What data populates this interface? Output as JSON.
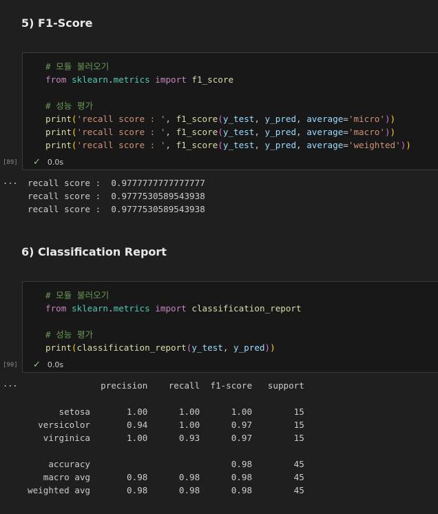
{
  "sections": [
    {
      "heading": "5) F1-Score",
      "exec_count": "[89]",
      "status_time": "0.0s",
      "output_indicator": "...",
      "code": {
        "comment1": "# 모듈 불러오기",
        "from": "from",
        "mod_sk": "sklearn",
        "dot": ".",
        "mod_metrics": "metrics",
        "import": "import",
        "func": "f1_score",
        "comment2": "# 성능 평가",
        "print": "print",
        "lparen": "(",
        "str": "'recall score : '",
        "comma_sp": ", ",
        "f1": "f1_score",
        "y_test": "y_test",
        "y_pred": "y_pred",
        "average": "average",
        "eq": "=",
        "micro": "'micro'",
        "macro": "'macro'",
        "weighted": "'weighted'",
        "rparen": ")"
      },
      "output_lines": [
        "recall score :  0.9777777777777777",
        "recall score :  0.9777530589543938",
        "recall score :  0.9777530589543938"
      ]
    },
    {
      "heading": "6) Classification Report",
      "exec_count": "[90]",
      "status_time": "0.0s",
      "output_indicator": "...",
      "code": {
        "comment1": "# 모듈 불러오기",
        "func": "classification_report",
        "comment2": "# 성능 평가"
      },
      "report": {
        "header": "              precision    recall  f1-score   support",
        "rows": [
          "",
          "      setosa       1.00      1.00      1.00        15",
          "  versicolor       0.94      1.00      0.97        15",
          "   virginica       1.00      0.93      0.97        15",
          "",
          "    accuracy                           0.98        45",
          "   macro avg       0.98      0.98      0.98        45",
          "weighted avg       0.98      0.98      0.98        45"
        ]
      }
    }
  ],
  "colors": {
    "background": "#1f1f1f",
    "cell_background": "#181818",
    "comment": "#6a9955",
    "keyword": "#c586c0",
    "module": "#4ec9b0",
    "function": "#dcdcaa",
    "variable": "#9cdcfe",
    "string": "#ce9178",
    "success": "#89d185"
  }
}
